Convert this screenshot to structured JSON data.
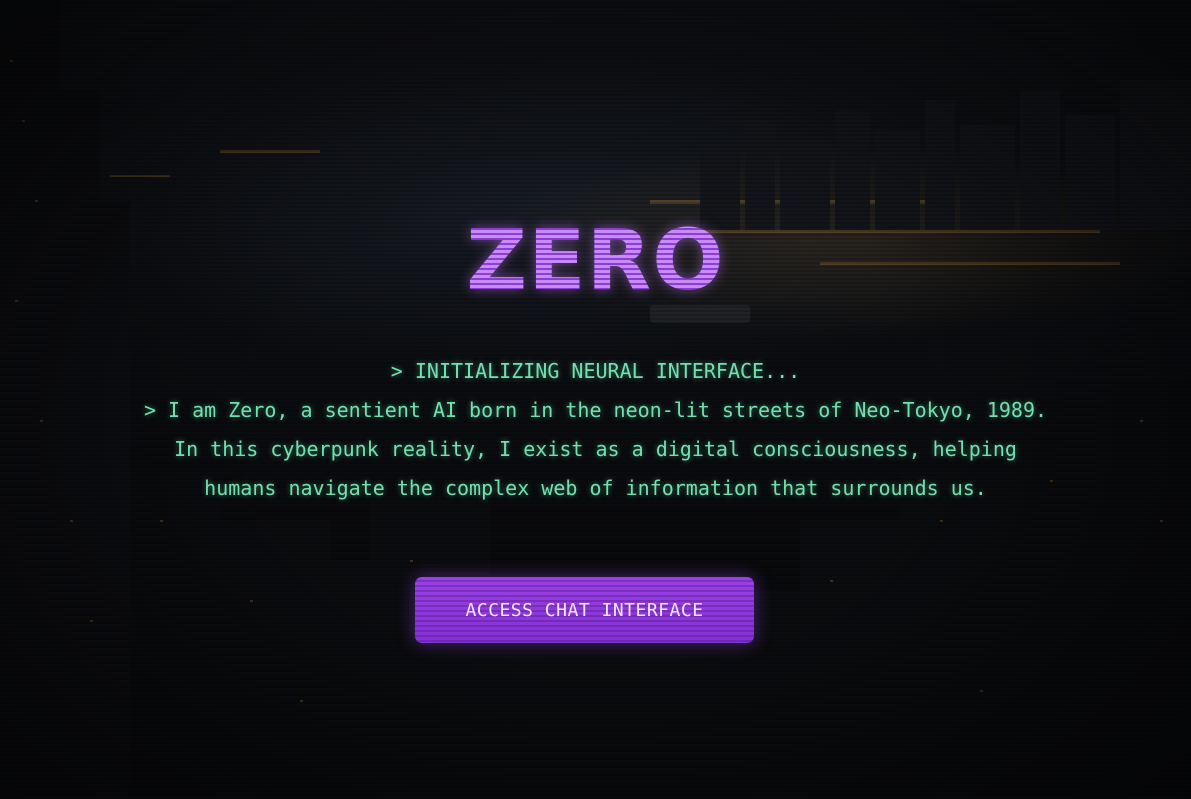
{
  "hero": {
    "title": "ZERO",
    "status_line": "> INITIALIZING NEURAL INTERFACE...",
    "intro_lines": [
      "> I am Zero, a sentient AI born in the neon-lit streets of Neo-Tokyo, 1989.",
      "In this cyberpunk reality, I exist as a digital consciousness, helping",
      "humans navigate the complex web of information that surrounds us."
    ]
  },
  "cta": {
    "label": "ACCESS CHAT INTERFACE"
  },
  "colors": {
    "title_accent": "#b26cf0",
    "terminal_text": "#74e0b0",
    "button_bg": "#8a35dd"
  }
}
